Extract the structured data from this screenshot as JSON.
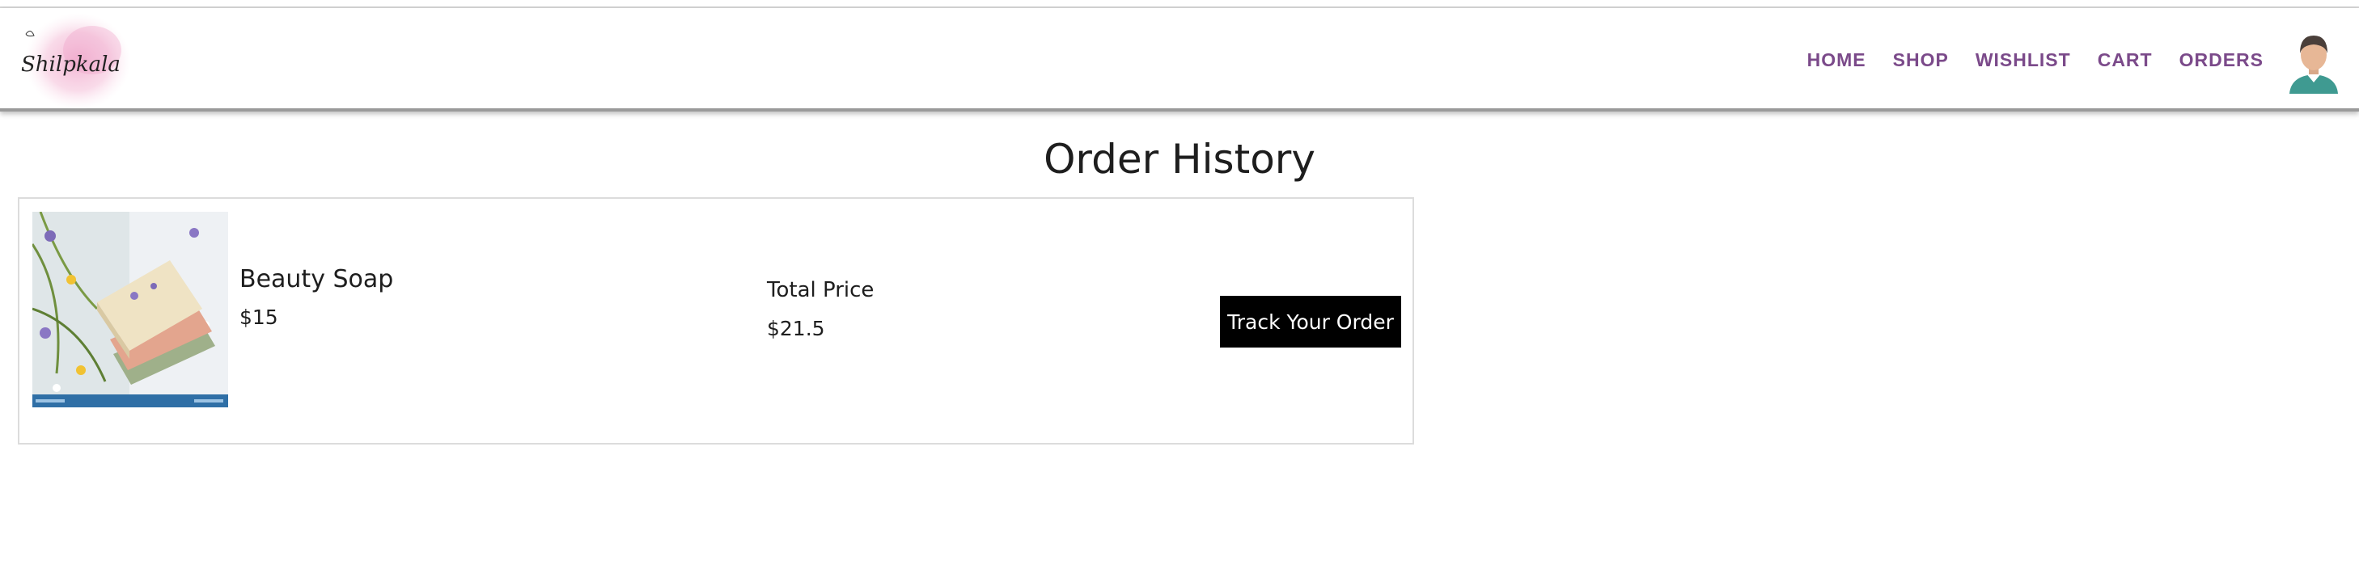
{
  "brand": {
    "logo_text": "Shilpkala"
  },
  "nav": {
    "items": [
      {
        "label": "HOME"
      },
      {
        "label": "SHOP"
      },
      {
        "label": "WISHLIST"
      },
      {
        "label": "CART"
      },
      {
        "label": "ORDERS"
      }
    ],
    "avatar_icon": "user-avatar-icon",
    "link_color": "#7b4a8a"
  },
  "page": {
    "title": "Order History"
  },
  "orders": [
    {
      "product_name": "Beauty Soap",
      "price": "$15",
      "total_label": "Total Price",
      "total_value": "$21.5",
      "track_label": "Track Your Order",
      "image_icon": "soap-product-photo"
    }
  ]
}
